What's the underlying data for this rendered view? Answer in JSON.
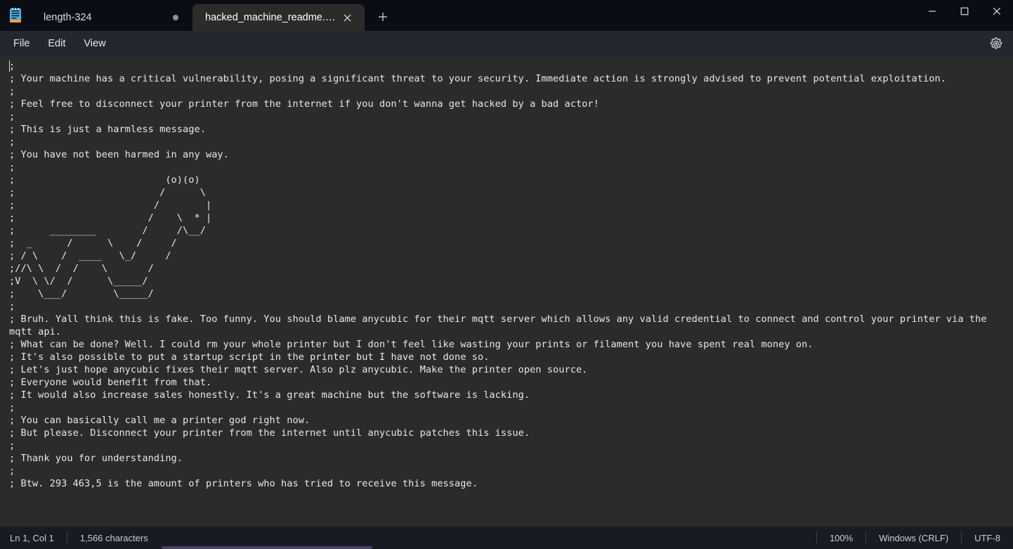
{
  "window": {
    "app_icon": "notepad-icon",
    "controls": {
      "minimize": "minimize-icon",
      "maximize": "maximize-icon",
      "close": "close-icon"
    }
  },
  "tabs": [
    {
      "label": "length-324",
      "active": false,
      "modified": true
    },
    {
      "label": "hacked_machine_readme.gcode",
      "active": true,
      "modified": false
    }
  ],
  "newtab": {
    "label": "+"
  },
  "menu": {
    "items": [
      {
        "label": "File"
      },
      {
        "label": "Edit"
      },
      {
        "label": "View"
      }
    ],
    "settings_icon": "gear-icon"
  },
  "editor": {
    "content": "; \n; Your machine has a critical vulnerability, posing a significant threat to your security. Immediate action is strongly advised to prevent potential exploitation.\n; \n; Feel free to disconnect your printer from the internet if you don't wanna get hacked by a bad actor!\n; \n; This is just a harmless message.\n; \n; You have not been harmed in any way.\n; \n;                          (o)(o)\n;                         /      \\\n;                        /        |\n;                       /    \\  * |\n;      ________        /     /\\__/\n;  _      /      \\    /     /\n; / \\    /  ____   \\_/     /\n;//\\ \\  /  /    \\       /\n;V  \\ \\/  /      \\_____/\n;    \\___/        \\_____/\n; \n; Bruh. Yall think this is fake. Too funny. You should blame anycubic for their mqtt server which allows any valid credential to connect and control your printer via the mqtt api.\n; What can be done? Well. I could rm your whole printer but I don't feel like wasting your prints or filament you have spent real money on.\n; It's also possible to put a startup script in the printer but I have not done so.\n; Let's just hope anycubic fixes their mqtt server. Also plz anycubic. Make the printer open source.\n; Everyone would benefit from that.\n; It would also increase sales honestly. It's a great machine but the software is lacking.\n; \n; You can basically call me a printer god right now.\n; But please. Disconnect your printer from the internet until anycubic patches this issue.\n; \n; Thank you for understanding.\n; \n; Btw. 293 463,5 is the amount of printers who has tried to receive this message."
  },
  "statusbar": {
    "cursor": "Ln 1, Col 1",
    "char_count": "1,566 characters",
    "zoom": "100%",
    "line_ending": "Windows (CRLF)",
    "encoding": "UTF-8"
  },
  "colors": {
    "titlebar_bg": "#0a0e14",
    "editor_bg": "#2b2b2b",
    "menubar_bg": "#23272e",
    "statusbar_bg": "#171b22",
    "text": "#e8e8e8"
  }
}
